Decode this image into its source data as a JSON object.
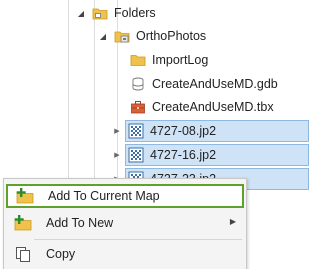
{
  "tree": {
    "folders": "Folders",
    "orthophotos": "OrthoPhotos",
    "items": [
      {
        "label": "ImportLog",
        "icon": "folder-icon"
      },
      {
        "label": "CreateAndUseMD.gdb",
        "icon": "geodatabase-icon"
      },
      {
        "label": "CreateAndUseMD.tbx",
        "icon": "toolbox-icon"
      },
      {
        "label": "4727-08.jp2",
        "icon": "raster-icon"
      },
      {
        "label": "4727-16.jp2",
        "icon": "raster-icon"
      },
      {
        "label": "4727-23.jp2",
        "icon": "raster-icon"
      }
    ]
  },
  "context_menu": {
    "add_to_current_map": "Add To Current Map",
    "add_to_new": "Add To New",
    "copy": "Copy"
  },
  "colors": {
    "selection": "#cfe3f7",
    "highlight_border": "#5ea22c",
    "folder": "#f0c24b"
  }
}
